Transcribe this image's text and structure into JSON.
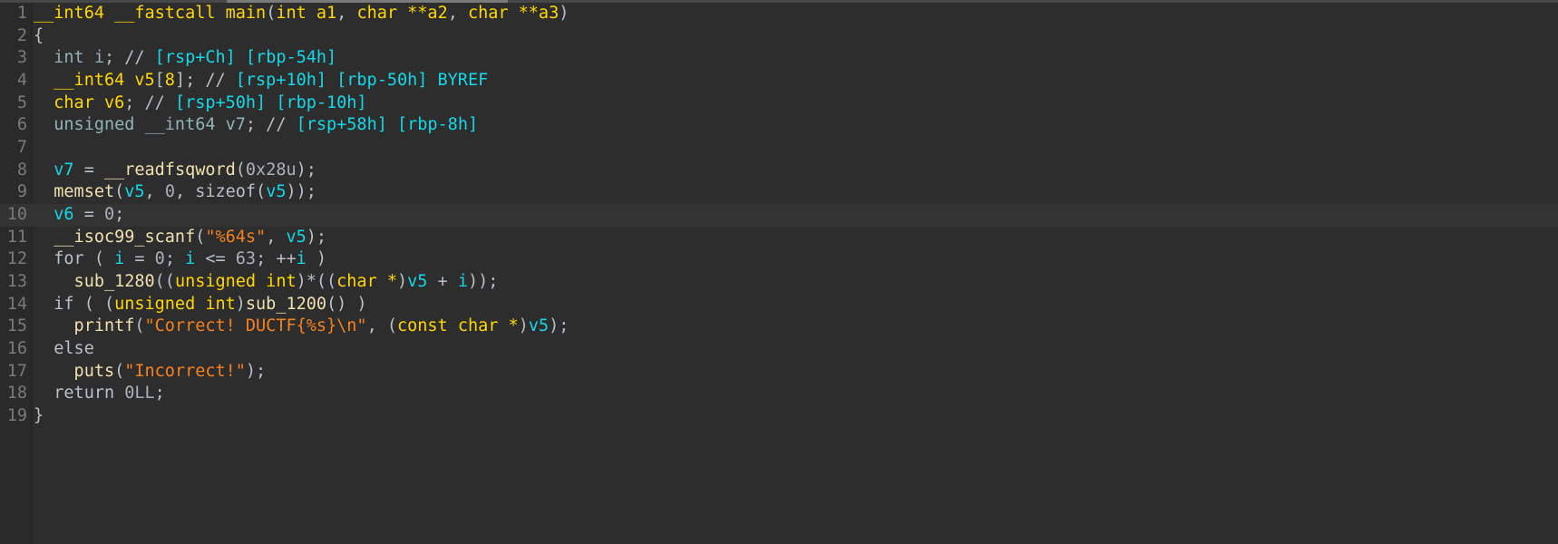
{
  "editor": {
    "current_line": 10,
    "horizontal_scroll": {
      "thumb_start_fraction": 0.146,
      "thumb_size_fraction": 0.18
    },
    "lines": [
      {
        "n": "1",
        "tokens": [
          [
            "yel",
            "__int64 __fastcall main"
          ],
          [
            "gray",
            "("
          ],
          [
            "yel",
            "int a1"
          ],
          [
            "gray",
            ", "
          ],
          [
            "yel",
            "char **a2"
          ],
          [
            "gray",
            ", "
          ],
          [
            "yel",
            "char **a3"
          ],
          [
            "gray",
            ")"
          ]
        ]
      },
      {
        "n": "2",
        "tokens": [
          [
            "gray",
            "{"
          ]
        ]
      },
      {
        "n": "3",
        "tokens": [
          [
            "decl",
            "  int i"
          ],
          [
            "gray",
            "; // "
          ],
          [
            "cyan",
            "[rsp+Ch] [rbp-54h]"
          ]
        ]
      },
      {
        "n": "4",
        "tokens": [
          [
            "yel",
            "  __int64 v5"
          ],
          [
            "gray",
            "["
          ],
          [
            "yel",
            "8"
          ],
          [
            "gray",
            "]; // "
          ],
          [
            "cyan",
            "[rsp+10h] [rbp-50h] BYREF"
          ]
        ]
      },
      {
        "n": "5",
        "tokens": [
          [
            "yel",
            "  char v6"
          ],
          [
            "gray",
            "; // "
          ],
          [
            "cyan",
            "[rsp+50h] [rbp-10h]"
          ]
        ]
      },
      {
        "n": "6",
        "tokens": [
          [
            "decl",
            "  unsigned __int64 v7"
          ],
          [
            "gray",
            "; // "
          ],
          [
            "cyan",
            "[rsp+58h] [rbp-8h]"
          ]
        ]
      },
      {
        "n": "7",
        "tokens": []
      },
      {
        "n": "8",
        "tokens": [
          [
            "cyan",
            "  v7"
          ],
          [
            "gray",
            " = "
          ],
          [
            "fn",
            "__readfsqword"
          ],
          [
            "gray",
            "("
          ],
          [
            "num",
            "0x28u"
          ],
          [
            "gray",
            ");"
          ]
        ]
      },
      {
        "n": "9",
        "tokens": [
          [
            "fn",
            "  memset"
          ],
          [
            "gray",
            "("
          ],
          [
            "cyan",
            "v5"
          ],
          [
            "gray",
            ", "
          ],
          [
            "num",
            "0"
          ],
          [
            "gray",
            ", sizeof("
          ],
          [
            "cyan",
            "v5"
          ],
          [
            "gray",
            "));"
          ]
        ]
      },
      {
        "n": "10",
        "tokens": [
          [
            "cyan",
            "  v6"
          ],
          [
            "gray",
            " = "
          ],
          [
            "num",
            "0"
          ],
          [
            "gray",
            ";"
          ]
        ]
      },
      {
        "n": "11",
        "tokens": [
          [
            "fn",
            "  __isoc99_scanf"
          ],
          [
            "gray",
            "("
          ],
          [
            "orange",
            "\"%64s\""
          ],
          [
            "gray",
            ", "
          ],
          [
            "cyan",
            "v5"
          ],
          [
            "gray",
            ");"
          ]
        ]
      },
      {
        "n": "12",
        "tokens": [
          [
            "gray",
            "  for ( "
          ],
          [
            "cyan",
            "i"
          ],
          [
            "gray",
            " = "
          ],
          [
            "num",
            "0"
          ],
          [
            "gray",
            "; "
          ],
          [
            "cyan",
            "i"
          ],
          [
            "gray",
            " <= "
          ],
          [
            "num",
            "63"
          ],
          [
            "gray",
            "; ++"
          ],
          [
            "cyan",
            "i"
          ],
          [
            "gray",
            " )"
          ]
        ]
      },
      {
        "n": "13",
        "tokens": [
          [
            "fn",
            "    sub_1280"
          ],
          [
            "gray",
            "(("
          ],
          [
            "yel",
            "unsigned int"
          ],
          [
            "gray",
            ")*(("
          ],
          [
            "yel",
            "char *"
          ],
          [
            "gray",
            ")"
          ],
          [
            "cyan",
            "v5"
          ],
          [
            "gray",
            " + "
          ],
          [
            "cyan",
            "i"
          ],
          [
            "gray",
            "));"
          ]
        ]
      },
      {
        "n": "14",
        "tokens": [
          [
            "gray",
            "  if ( ("
          ],
          [
            "yel",
            "unsigned int"
          ],
          [
            "gray",
            ")"
          ],
          [
            "fn",
            "sub_1200"
          ],
          [
            "gray",
            "() )"
          ]
        ]
      },
      {
        "n": "15",
        "tokens": [
          [
            "fn",
            "    printf"
          ],
          [
            "gray",
            "("
          ],
          [
            "orange",
            "\"Correct! DUCTF{%s}\\n\""
          ],
          [
            "gray",
            ", ("
          ],
          [
            "yel",
            "const char *"
          ],
          [
            "gray",
            ")"
          ],
          [
            "cyan",
            "v5"
          ],
          [
            "gray",
            ");"
          ]
        ]
      },
      {
        "n": "16",
        "tokens": [
          [
            "gray",
            "  else"
          ]
        ]
      },
      {
        "n": "17",
        "tokens": [
          [
            "fn",
            "    puts"
          ],
          [
            "gray",
            "("
          ],
          [
            "orange",
            "\"Incorrect!\""
          ],
          [
            "gray",
            ");"
          ]
        ]
      },
      {
        "n": "18",
        "tokens": [
          [
            "gray",
            "  return "
          ],
          [
            "num",
            "0LL"
          ],
          [
            "gray",
            ";"
          ]
        ]
      },
      {
        "n": "19",
        "tokens": [
          [
            "gray",
            "}"
          ]
        ]
      }
    ]
  }
}
